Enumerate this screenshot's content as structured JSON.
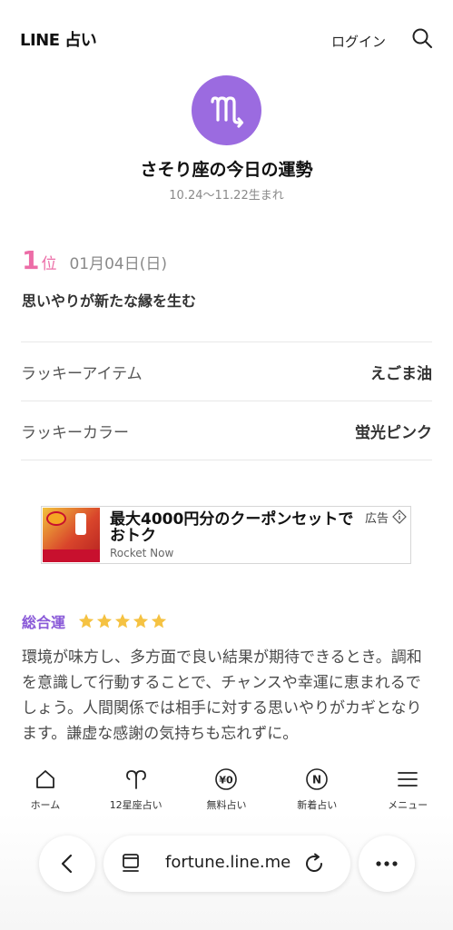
{
  "header": {
    "logo": "LINE 占い",
    "login_label": "ログイン"
  },
  "sign": {
    "icon": "scorpio-symbol-icon",
    "title": "さそり座の今日の運勢",
    "dates": "10.24〜11.22生まれ",
    "color": "#9b6be0"
  },
  "rank": {
    "number": "1",
    "suffix": "位",
    "date": "01月04日(日)",
    "color": "#ec6da7"
  },
  "headline": "思いやりが新たな縁を生む",
  "lucky": [
    {
      "label": "ラッキーアイテム",
      "value": "えごま油"
    },
    {
      "label": "ラッキーカラー",
      "value": "蛍光ピンク"
    }
  ],
  "ad": {
    "title": "最大4000円分のクーポンセットでおトク",
    "sponsor": "Rocket Now",
    "label": "広告"
  },
  "fortune": {
    "label": "総合運",
    "stars": 5,
    "star_color": "#f5c242",
    "text": "環境が味方し、多方面で良い結果が期待できるとき。調和を意識して行動することで、チャンスや幸運に恵まれるでしょう。人間関係では相手に対する思いやりがカギとなります。謙虚な感謝の気持ちも忘れずに。"
  },
  "bottom_nav": [
    {
      "icon": "home-icon",
      "label": "ホーム"
    },
    {
      "icon": "aries-symbol-icon",
      "label": "12星座占い"
    },
    {
      "icon": "yen-zero-icon",
      "label": "無料占い"
    },
    {
      "icon": "new-circle-icon",
      "label": "新着占い"
    },
    {
      "icon": "hamburger-menu-icon",
      "label": "メニュー"
    }
  ],
  "browser": {
    "url": "fortune.line.me"
  }
}
